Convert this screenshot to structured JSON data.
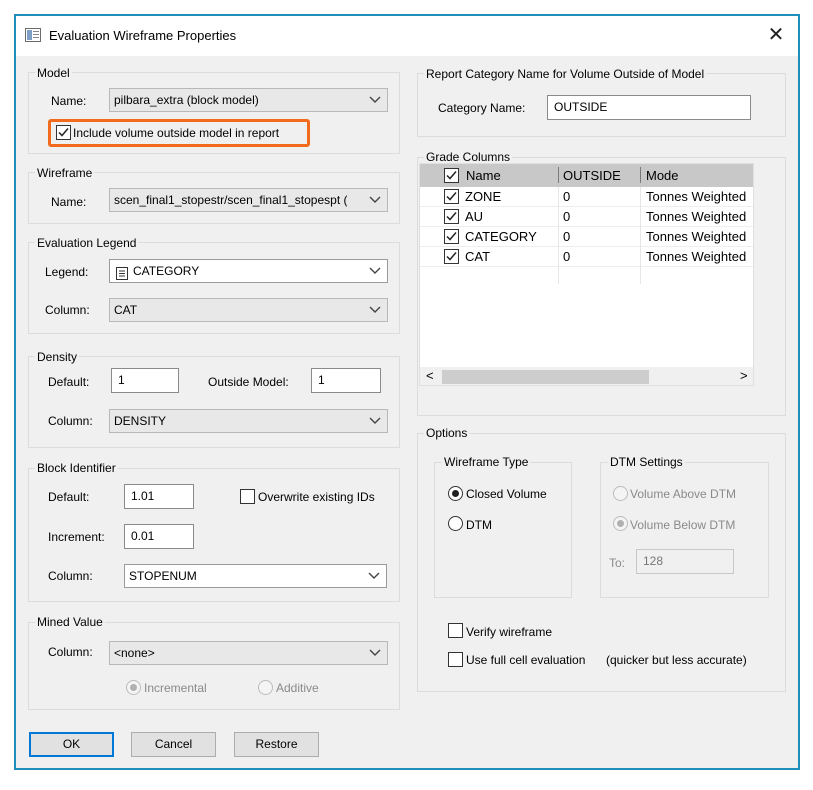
{
  "window": {
    "title": "Evaluation Wireframe Properties",
    "close": "✕"
  },
  "model": {
    "group_label": "Model",
    "name_label": "Name:",
    "name_value": "pilbara_extra (block model)",
    "include_label": "Include volume outside model in report",
    "include_checked": true
  },
  "wireframe": {
    "group_label": "Wireframe",
    "name_label": "Name:",
    "name_value": "scen_final1_stopestr/scen_final1_stopespt ("
  },
  "legend": {
    "group_label": "Evaluation Legend",
    "legend_label": "Legend:",
    "legend_value": "CATEGORY",
    "column_label": "Column:",
    "column_value": "CAT"
  },
  "density": {
    "group_label": "Density",
    "default_label": "Default:",
    "default_value": "1",
    "outside_label": "Outside Model:",
    "outside_value": "1",
    "column_label": "Column:",
    "column_value": "DENSITY"
  },
  "block_id": {
    "group_label": "Block Identifier",
    "default_label": "Default:",
    "default_value": "1.01",
    "overwrite_label": "Overwrite existing IDs",
    "overwrite_checked": false,
    "increment_label": "Increment:",
    "increment_value": "0.01",
    "column_label": "Column:",
    "column_value": "STOPENUM"
  },
  "mined": {
    "group_label": "Mined Value",
    "column_label": "Column:",
    "column_value": "<none>",
    "incremental_label": "Incremental",
    "additive_label": "Additive"
  },
  "report_category": {
    "group_label": "Report Category Name for Volume Outside of Model",
    "category_label": "Category Name:",
    "category_value": "OUTSIDE"
  },
  "grade_columns": {
    "group_label": "Grade Columns",
    "headers": [
      "Name",
      "OUTSIDE",
      "Mode"
    ],
    "rows": [
      {
        "name": "ZONE",
        "outside": "0",
        "mode": "Tonnes Weighted"
      },
      {
        "name": "AU",
        "outside": "0",
        "mode": "Tonnes Weighted"
      },
      {
        "name": "CATEGORY",
        "outside": "0",
        "mode": "Tonnes Weighted"
      },
      {
        "name": "CAT",
        "outside": "0",
        "mode": "Tonnes Weighted"
      }
    ],
    "scroll_left": "<",
    "scroll_right": ">"
  },
  "options": {
    "group_label": "Options",
    "wireframe_type_label": "Wireframe Type",
    "closed_volume_label": "Closed Volume",
    "dtm_label": "DTM",
    "dtm_settings_label": "DTM Settings",
    "above_label": "Volume Above DTM",
    "below_label": "Volume Below DTM",
    "to_label": "To:",
    "to_value": "128",
    "verify_label": "Verify wireframe",
    "full_cell_label": "Use full cell evaluation",
    "full_cell_note": "(quicker but less accurate)"
  },
  "buttons": {
    "ok": "OK",
    "cancel": "Cancel",
    "restore": "Restore"
  }
}
